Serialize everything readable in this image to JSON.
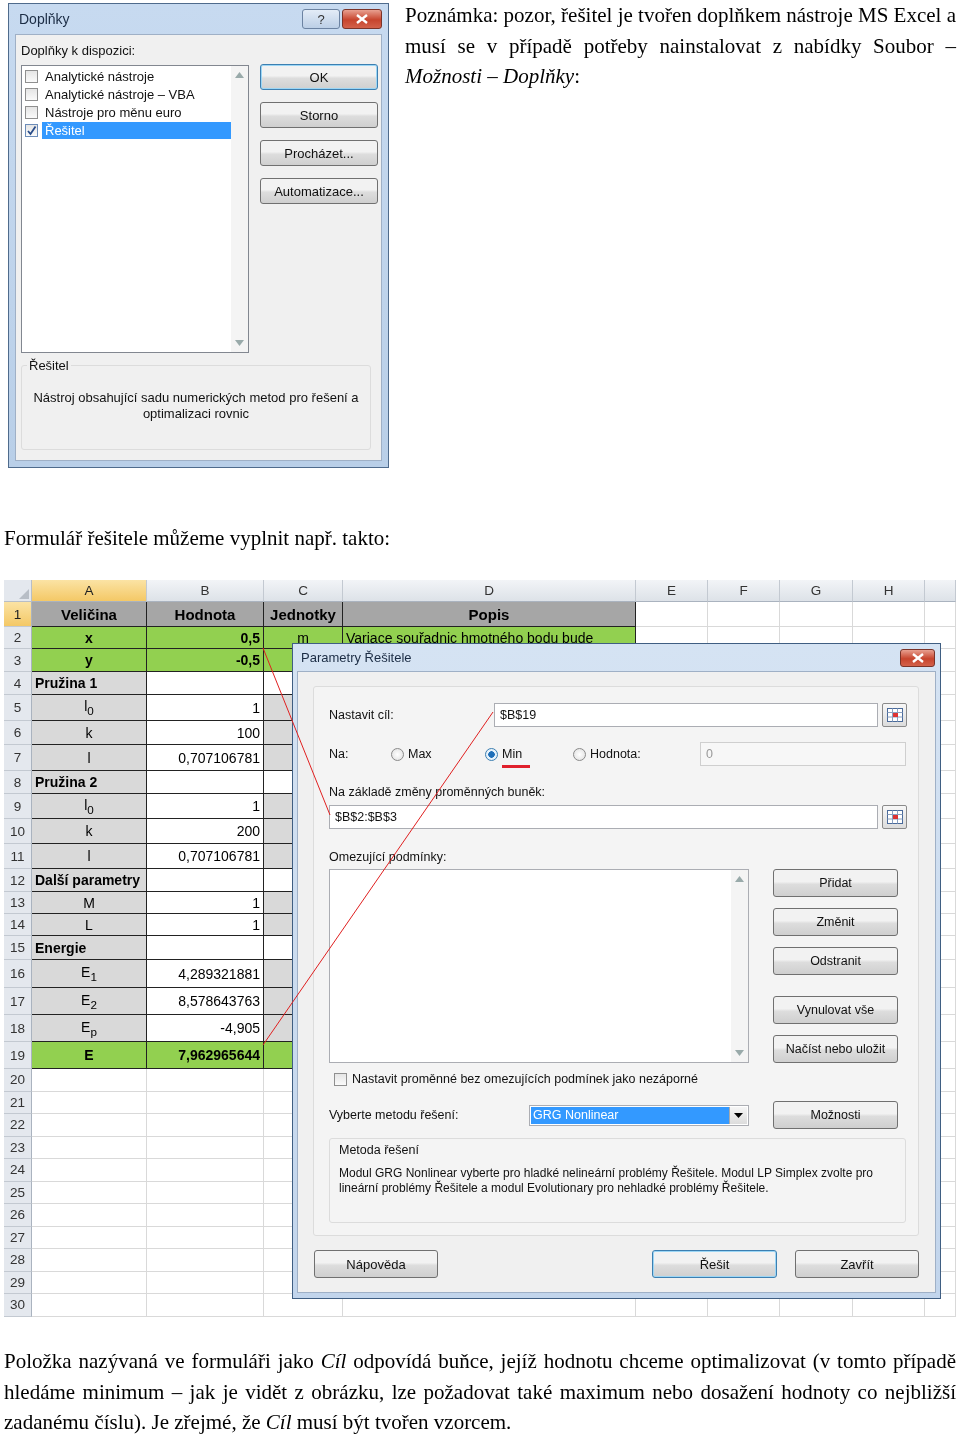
{
  "addins_dialog": {
    "title": "Doplňky",
    "help_button": "?",
    "available_label": "Doplňky k dispozici:",
    "items": [
      {
        "label": "Analytické nástroje",
        "checked": false,
        "selected": false
      },
      {
        "label": "Analytické nástroje – VBA",
        "checked": false,
        "selected": false
      },
      {
        "label": "Nástroje pro měnu euro",
        "checked": false,
        "selected": false
      },
      {
        "label": "Řešitel",
        "checked": true,
        "selected": true
      }
    ],
    "buttons": [
      {
        "label": "OK",
        "default": true
      },
      {
        "label": "Storno",
        "default": false
      },
      {
        "label": "Procházet...",
        "default": false
      },
      {
        "label": "Automatizace...",
        "default": false
      }
    ],
    "description_group": {
      "title": "Řešitel",
      "text": "Nástroj obsahující sadu numerických metod pro řešení a optimalizaci rovnic"
    }
  },
  "note": "Poznámka: pozor, řešitel je tvořen doplňkem nástroje MS Excel a musí se v případě potřeby nainstalovat z nabídky Soubor – *Možnosti* – *Doplňky*:",
  "intro": "Formulář řešitele můžeme vyplnit např. takto:",
  "spreadsheet": {
    "columns": [
      {
        "label": "A",
        "selected": true
      },
      {
        "label": "B",
        "selected": false
      },
      {
        "label": "C",
        "selected": false
      },
      {
        "label": "D",
        "selected": false
      },
      {
        "label": "E",
        "selected": false
      },
      {
        "label": "F",
        "selected": false
      },
      {
        "label": "G",
        "selected": false
      },
      {
        "label": "H",
        "selected": false
      }
    ],
    "rows": [
      {
        "number": "1",
        "selected": true,
        "kind": "header",
        "cells": [
          "Veličina",
          "Hodnota",
          "Jednotky",
          "Popis"
        ]
      },
      {
        "number": "2",
        "selected": false,
        "kind": "input",
        "cells": [
          "x",
          "0,5",
          "m",
          "Variace souřadnic hmotného bodu bude"
        ]
      },
      {
        "number": "3",
        "selected": false,
        "kind": "input",
        "cells": [
          "y",
          "-0,5"
        ]
      },
      {
        "number": "4",
        "selected": false,
        "kind": "section",
        "cells": [
          "Pružina 1"
        ]
      },
      {
        "number": "5",
        "selected": false,
        "kind": "param",
        "cells": [
          "l$_{0}$",
          "1"
        ]
      },
      {
        "number": "6",
        "selected": false,
        "kind": "param",
        "cells": [
          "k",
          "100"
        ]
      },
      {
        "number": "7",
        "selected": false,
        "kind": "param",
        "cells": [
          "l",
          "0,707106781"
        ]
      },
      {
        "number": "8",
        "selected": false,
        "kind": "section",
        "cells": [
          "Pružina 2"
        ]
      },
      {
        "number": "9",
        "selected": false,
        "kind": "param",
        "cells": [
          "l$_{0}$",
          "1"
        ]
      },
      {
        "number": "10",
        "selected": false,
        "kind": "param",
        "cells": [
          "k",
          "200"
        ]
      },
      {
        "number": "11",
        "selected": false,
        "kind": "param",
        "cells": [
          "l",
          "0,707106781"
        ]
      },
      {
        "number": "12",
        "selected": false,
        "kind": "section",
        "cells": [
          "Další parametry"
        ]
      },
      {
        "number": "13",
        "selected": false,
        "kind": "param",
        "cells": [
          "M",
          "1"
        ]
      },
      {
        "number": "14",
        "selected": false,
        "kind": "param",
        "cells": [
          "L",
          "1"
        ]
      },
      {
        "number": "15",
        "selected": false,
        "kind": "section",
        "cells": [
          "Energie"
        ]
      },
      {
        "number": "16",
        "selected": false,
        "kind": "param",
        "cells": [
          "E$_{1}$",
          "4,289321881"
        ]
      },
      {
        "number": "17",
        "selected": false,
        "kind": "param",
        "cells": [
          "E$_{2}$",
          "8,578643763"
        ]
      },
      {
        "number": "18",
        "selected": false,
        "kind": "param",
        "cells": [
          "E$_{p}$",
          "-4,905"
        ]
      },
      {
        "number": "19",
        "selected": false,
        "kind": "result",
        "cells": [
          "E",
          "7,962965644"
        ]
      },
      {
        "number": "20",
        "selected": false,
        "kind": "empty",
        "cells": []
      },
      {
        "number": "21",
        "selected": false,
        "kind": "empty",
        "cells": []
      },
      {
        "number": "22",
        "selected": false,
        "kind": "empty",
        "cells": []
      },
      {
        "number": "23",
        "selected": false,
        "kind": "empty",
        "cells": []
      },
      {
        "number": "24",
        "selected": false,
        "kind": "empty",
        "cells": []
      },
      {
        "number": "25",
        "selected": false,
        "kind": "empty",
        "cells": []
      },
      {
        "number": "26",
        "selected": false,
        "kind": "empty",
        "cells": []
      },
      {
        "number": "27",
        "selected": false,
        "kind": "empty",
        "cells": []
      },
      {
        "number": "28",
        "selected": false,
        "kind": "empty",
        "cells": []
      },
      {
        "number": "29",
        "selected": false,
        "kind": "empty",
        "cells": []
      },
      {
        "number": "30",
        "selected": false,
        "kind": "empty",
        "cells": []
      }
    ]
  },
  "solver_dialog": {
    "title": "Parametry Řešitele",
    "objective_label": "Nastavit cíl:",
    "objective_value": "$B$19",
    "to_label": "Na:",
    "options": [
      {
        "label": "Max",
        "selected": false
      },
      {
        "label": "Min",
        "selected": true
      },
      {
        "label": "Hodnota:",
        "selected": false
      }
    ],
    "value_field": "0",
    "variables_label": "Na základě změny proměnných buněk:",
    "variables_value": "$B$2:$B$3",
    "constraints_label": "Omezující podmínky:",
    "constraint_buttons": [
      "Přidat",
      "Změnit",
      "Odstranit",
      "Vynulovat vše",
      "Načíst nebo uložit"
    ],
    "nonnegative": {
      "label": "Nastavit proměnné bez omezujících podmínek jako nezáporné",
      "checked": false
    },
    "method_label": "Vyberte metodu řešení:",
    "method_value": "GRG Nonlinear",
    "options_button": "Možnosti",
    "method_group": {
      "title": "Metoda řešení",
      "text": "Modul GRG Nonlinear vyberte pro hladké nelineární problémy Řešitele. Modul LP Simplex zvolte pro lineární problémy Řešitele a modul Evolutionary pro nehladké problémy Řešitele."
    },
    "bottom_buttons": [
      {
        "label": "Nápověda",
        "default": false
      },
      {
        "label": "Řešit",
        "default": true
      },
      {
        "label": "Zavřít",
        "default": false
      }
    ]
  },
  "closing": "Položka nazývaná ve formuláři jako *Cíl* odpovídá buňce, jejíž hodnotu chceme optimalizovat (v tomto případě hledáme minimum – jak je vidět z obrázku, lze požadovat také maximum nebo dosažení hodnoty co nejbližší zadanému číslu). Je zřejmé, že *Cíl* musí být tvořen vzorcem."
}
